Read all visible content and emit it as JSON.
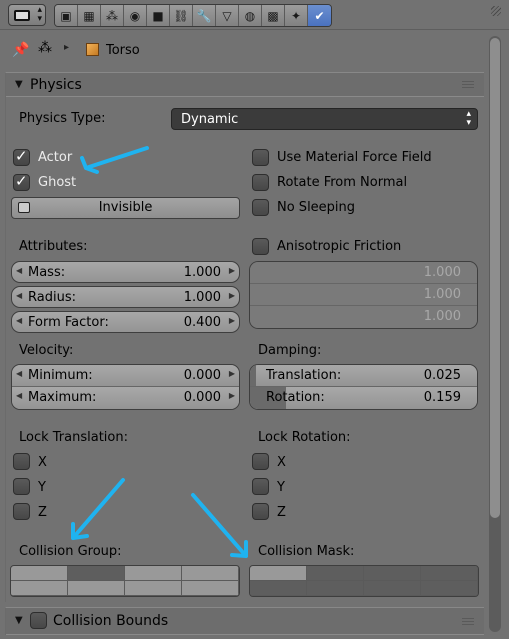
{
  "header": {
    "editor_type_icon": "properties-editor-icon",
    "tabs": [
      {
        "icon": "render-icon",
        "glyph": "▣"
      },
      {
        "icon": "render-layers-icon",
        "glyph": "▦"
      },
      {
        "icon": "scene-icon",
        "glyph": "⁂"
      },
      {
        "icon": "world-icon",
        "glyph": "◉"
      },
      {
        "icon": "object-icon",
        "glyph": "■"
      },
      {
        "icon": "constraints-icon",
        "glyph": "⛓"
      },
      {
        "icon": "modifiers-icon",
        "glyph": "🔧"
      },
      {
        "icon": "data-icon",
        "glyph": "▽"
      },
      {
        "icon": "material-icon",
        "glyph": "◍"
      },
      {
        "icon": "texture-icon",
        "glyph": "▩"
      },
      {
        "icon": "particles-icon",
        "glyph": "✦"
      },
      {
        "icon": "physics-icon",
        "glyph": "✔"
      }
    ],
    "active_tab": "physics-icon"
  },
  "breadcrumb": {
    "object_name": "Torso"
  },
  "physics_panel": {
    "title": "Physics",
    "physics_type_label": "Physics Type:",
    "physics_type_value": "Dynamic",
    "actor_label": "Actor",
    "actor_checked": true,
    "ghost_label": "Ghost",
    "ghost_checked": true,
    "invisible_label": "Invisible",
    "use_material_force_field_label": "Use Material Force Field",
    "rotate_from_normal_label": "Rotate From Normal",
    "no_sleeping_label": "No Sleeping",
    "attributes_label": "Attributes:",
    "mass_label": "Mass:",
    "mass_value": "1.000",
    "radius_label": "Radius:",
    "radius_value": "1.000",
    "form_factor_label": "Form Factor:",
    "form_factor_value": "0.400",
    "anisotropic_friction_label": "Anisotropic Friction",
    "anisotropic_values": [
      "1.000",
      "1.000",
      "1.000"
    ],
    "velocity_label": "Velocity:",
    "minimum_label": "Minimum:",
    "minimum_value": "0.000",
    "maximum_label": "Maximum:",
    "maximum_value": "0.000",
    "damping_label": "Damping:",
    "translation_label": "Translation:",
    "translation_value": "0.025",
    "rotation_label": "Rotation:",
    "rotation_value": "0.159",
    "lock_translation_label": "Lock Translation:",
    "lock_rotation_label": "Lock Rotation:",
    "axis_x": "X",
    "axis_y": "Y",
    "axis_z": "Z",
    "collision_group_label": "Collision Group:",
    "collision_mask_label": "Collision Mask:"
  },
  "collision_bounds_panel": {
    "title": "Collision Bounds"
  },
  "colors": {
    "background": "#727272",
    "active_tab": "#5680c2",
    "annotation_arrow": "#1fb3f0"
  }
}
